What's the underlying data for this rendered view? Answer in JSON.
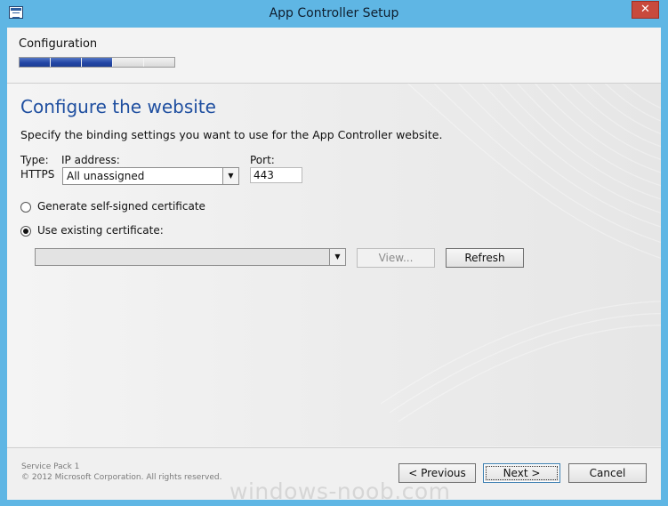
{
  "window": {
    "title": "App Controller Setup",
    "close_glyph": "✕"
  },
  "header": {
    "section": "Configuration",
    "progress": {
      "completed_steps": 3,
      "total_steps": 5
    }
  },
  "page": {
    "title": "Configure the website",
    "instruction": "Specify the binding settings you want to use for the App Controller website.",
    "type_label": "Type:",
    "type_value": "HTTPS",
    "ip_label": "IP address:",
    "ip_value": "All unassigned",
    "port_label": "Port:",
    "port_value": "443",
    "radio_self_signed": "Generate self-signed certificate",
    "radio_existing": "Use existing certificate:",
    "selected_option": "existing",
    "certificate_value": "",
    "view_label": "View...",
    "refresh_label": "Refresh"
  },
  "footer": {
    "service_pack": "Service Pack 1",
    "copyright": "© 2012 Microsoft Corporation. All rights reserved.",
    "previous_label": "< Previous",
    "next_label": "Next >",
    "cancel_label": "Cancel"
  },
  "watermark": "windows-noob.com",
  "colors": {
    "frame": "#5fb6e4",
    "title_accent": "#1f4fa0",
    "progress_fill": "#2346a6",
    "close_red": "#c84a3d"
  },
  "icons": {
    "app": "setup-window-icon",
    "close": "close-icon",
    "dropdown": "chevron-down-icon"
  }
}
